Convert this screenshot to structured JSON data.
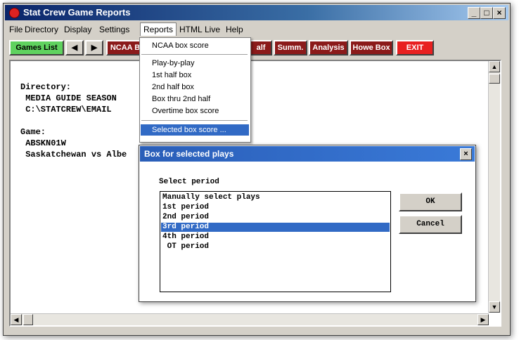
{
  "window": {
    "title": "Stat Crew Game Reports",
    "min": "_",
    "max": "□",
    "close": "×"
  },
  "menubar": [
    "File",
    "Directory",
    "Display",
    "Settings",
    "Reports",
    "HTML",
    "Live",
    "Help"
  ],
  "toolbar": {
    "games_list": "Games List",
    "prev": "◀",
    "next": "▶",
    "ncaa": "NCAA B",
    "half": "alf",
    "summ": "Summ.",
    "analysis": "Analysis",
    "howe": "Howe Box",
    "exit": "EXIT"
  },
  "content": {
    "directory_label": "Directory:",
    "directory_line1": " MEDIA GUIDE SEASON",
    "directory_line2": " C:\\STATCREW\\EMAIL",
    "game_label": "Game:",
    "game_id": " ABSKN01W",
    "game_teams": " Saskatchewan vs Albe"
  },
  "reports_menu": {
    "items": [
      "NCAA box score",
      "Play-by-play",
      "1st half box",
      "2nd half box",
      "Box thru 2nd half",
      "Overtime box score",
      "Selected box score ..."
    ],
    "selected_index": 6
  },
  "dialog": {
    "title": "Box for selected plays",
    "close": "×",
    "label": "Select period",
    "options": [
      "Manually select plays",
      "1st period",
      "2nd period",
      "3rd period",
      "4th period",
      " OT period"
    ],
    "selected_index": 3,
    "ok_label": "OK",
    "cancel_label": "Cancel"
  },
  "scrollbars": {
    "up": "▲",
    "down": "▼",
    "left": "◀",
    "right": "▶"
  }
}
